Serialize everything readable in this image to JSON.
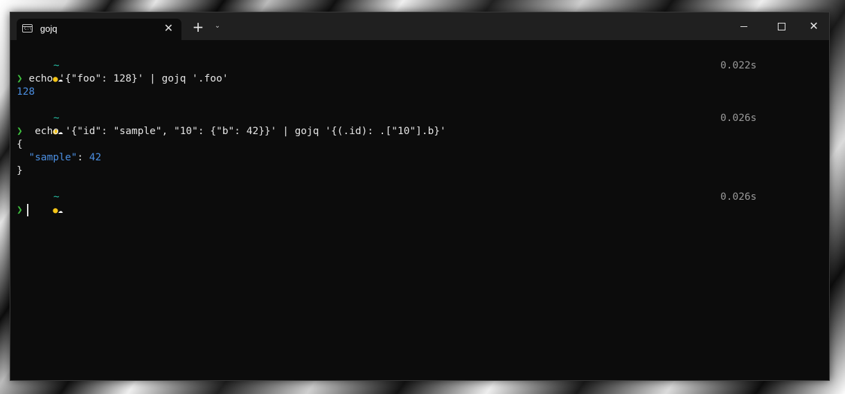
{
  "window": {
    "tab_title": "gojq",
    "tab_close_glyph": "✕",
    "new_tab_glyph": "+",
    "dropdown_glyph": "⌄",
    "close_glyph": "✕"
  },
  "terminal": {
    "blocks": [
      {
        "tilde": "~",
        "timing": "0.022s",
        "prompt_arrow": "❯",
        "command": " echo '{\"foo\": 128}' | gojq '.foo'",
        "output": [
          "128"
        ]
      },
      {
        "tilde": "~",
        "timing": "0.026s",
        "prompt_arrow": "❯",
        "command": "  echo '{\"id\": \"sample\", \"10\": {\"b\": 42}}' | gojq '{(.id): .[\"10\"].b}'",
        "output_open": "{",
        "output_key": "\"sample\"",
        "output_sep": ": ",
        "output_value": "42",
        "output_close": "}"
      },
      {
        "tilde": "~",
        "timing": "0.026s",
        "prompt_arrow": "❯"
      }
    ]
  },
  "colors": {
    "background": "#0c0c0c",
    "titlebar": "#202020",
    "prompt_arrow": "#3fc03f",
    "tilde": "#27c1a6",
    "number": "#4b8fe2",
    "timing": "#9a9a9a"
  },
  "icons": {
    "tab": "terminal-icon",
    "weather": "partly-cloudy-icon"
  }
}
